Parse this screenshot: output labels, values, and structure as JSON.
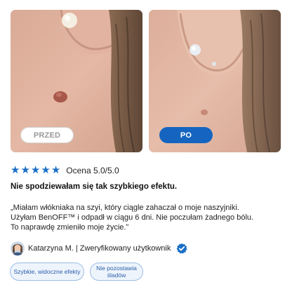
{
  "images": {
    "before_label": "PRZED",
    "after_label": "PO"
  },
  "rating": {
    "stars": 5,
    "text": "Ocena 5.0/5.0"
  },
  "review": {
    "headline": "Nie spodziewałam się tak szybkiego efektu.",
    "quote_lines": [
      "„Miałam włókniaka na szyi, który ciągle zahaczał o moje naszyjniki.",
      "Użyłam BenOFF™ i odpadł w ciągu 6 dni. Nie poczułam żadnego bólu.",
      "To naprawdę zmieniło moje życie.”"
    ],
    "author": "Katarzyna M. | Zweryfikowany użytkownik"
  },
  "tags": [
    "Szybkie, widoczne efekty",
    "Nie pozostawia śladów"
  ],
  "colors": {
    "accent": "#1565c0",
    "star": "#1a6fc7"
  }
}
